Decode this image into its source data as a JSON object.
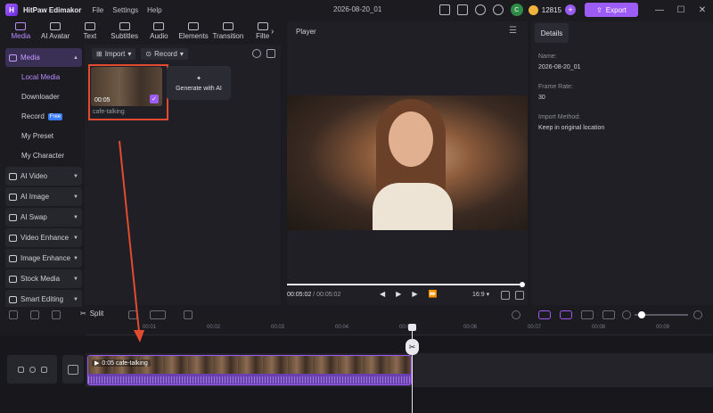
{
  "app": {
    "name": "HitPaw Edimakor",
    "logo_letter": "H",
    "menu": [
      "File",
      "Settings",
      "Help"
    ],
    "document_title": "2026-08-20_01",
    "avatar_initial": "C",
    "credits": "12815",
    "export_label": "Export"
  },
  "tabs": [
    {
      "label": "Media",
      "active": true
    },
    {
      "label": "AI Avatar"
    },
    {
      "label": "Text"
    },
    {
      "label": "Subtitles"
    },
    {
      "label": "Audio"
    },
    {
      "label": "Elements"
    },
    {
      "label": "Transition"
    },
    {
      "label": "Filte"
    }
  ],
  "sidebar": {
    "media_section": "Media",
    "sub_items": [
      "Local Media",
      "Downloader",
      "Record",
      "My Preset",
      "My Character"
    ],
    "record_badge": "Free",
    "groups": [
      "AI Video",
      "AI Image",
      "AI Swap",
      "Video Enhance",
      "Image Enhance",
      "Stock Media",
      "Smart Editing"
    ]
  },
  "media": {
    "import_label": "Import",
    "record_label": "Record",
    "clip_duration": "00:05",
    "clip_name": "cafe-talking",
    "generate_label": "Generate with AI"
  },
  "player": {
    "title": "Player",
    "current_time": "00:05:02",
    "separator": " / ",
    "total_time": "00:05:02",
    "aspect_ratio": "16:9",
    "progress": 1.0
  },
  "details": {
    "tab": "Details",
    "name_label": "Name:",
    "name_value": "2026-08-20_01",
    "frame_rate_label": "Frame Rate:",
    "frame_rate_value": "30",
    "import_method_label": "Import Method:",
    "import_method_value": "Keep in original location"
  },
  "timeline": {
    "split_label": "Split",
    "ruler_ticks": [
      "00:01",
      "00:02",
      "00:03",
      "00:04",
      "00:05",
      "00:06",
      "00:07",
      "00:08",
      "00:09"
    ],
    "clip_label": "0:05  cafe-talking"
  },
  "colors": {
    "accent": "#9d5cf5",
    "annotation": "#e24b30",
    "background": "#1b1b20"
  }
}
